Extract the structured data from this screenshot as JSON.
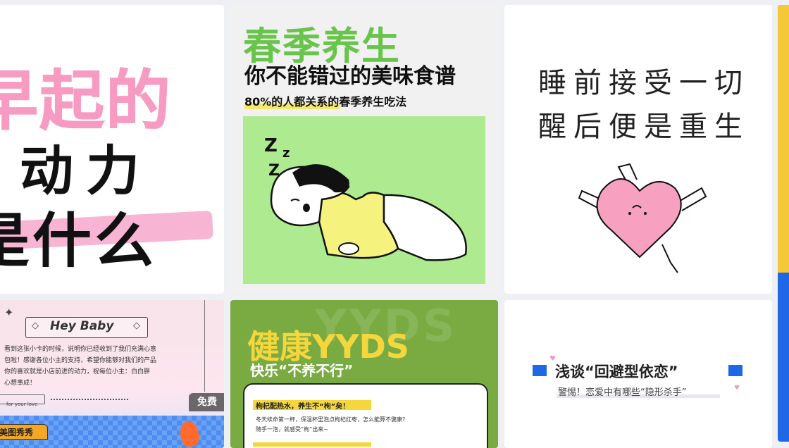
{
  "cards": [
    {
      "id": "morning",
      "lines": [
        "早起的",
        "动力",
        "是什么"
      ]
    },
    {
      "id": "spring",
      "title": "春季养生",
      "subtitle": "你不能错过的美味食谱",
      "tagline": "80%的人都关系的春季养生吃法"
    },
    {
      "id": "sleep",
      "lines": [
        "睡前接受一切",
        "醒后便是重生"
      ]
    },
    {
      "id": "heybaby",
      "title": "Hey Baby",
      "body": [
        "看到这张小卡的时候，说明你已经收到了我们充满心意",
        "包啦！感谢各位小主的支持，希望你能够对我们的产品",
        "你的喜欢就是小店前进的动力，祝每位小主：白白胖",
        "心想事成！"
      ],
      "footer": "for your love",
      "badge": "免费",
      "sub_banner": "美图秀秀"
    },
    {
      "id": "health",
      "title": "健康YYDS",
      "subtitle": "快乐“不养不行”",
      "bg_text": "YYDS",
      "note_title": "枸杞配热水，养生不“枸”矣！",
      "note_body": [
        "冬天续命第一杯，保温杯里泡点枸杞红枣，怎么能算不健康?",
        "随手一泡，就感受“枸”出来~"
      ]
    },
    {
      "id": "love",
      "title": "浅谈“回避型依恋”",
      "subtitle": "警惕！恋爱中有哪些“隐形杀手”"
    }
  ],
  "colors": {
    "page_bg": "#eef0f3",
    "pink": "#f79bc3",
    "green_title": "#69c44c",
    "light_green": "#aeea8f",
    "olive": "#79ab42",
    "yellow": "#f5d63d",
    "blue": "#1e67e6"
  }
}
